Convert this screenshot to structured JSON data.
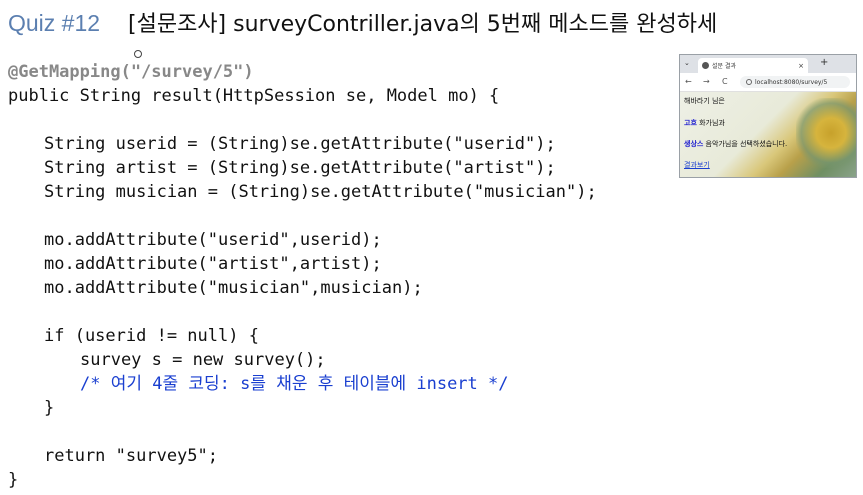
{
  "header": {
    "quiz_label": "Quiz #12",
    "title": "[설문조사] surveyContriller.java의 5번째 메소드를 완성하세"
  },
  "code": {
    "lines": [
      "@GetMapping(\"/survey/5\")",
      "public String result(HttpSession se, Model mo) {",
      "",
      "String userid = (String)se.getAttribute(\"userid\");",
      "String artist = (String)se.getAttribute(\"artist\");",
      "String musician = (String)se.getAttribute(\"musician\");",
      "",
      "mo.addAttribute(\"userid\",userid);",
      "mo.addAttribute(\"artist\",artist);",
      "mo.addAttribute(\"musician\",musician);",
      "",
      "if (userid != null) {",
      "survey s = new survey();",
      "/* 여기 4줄 코딩: s를 채운 후 테이블에 insert */",
      "}",
      "",
      "return \"survey5\";",
      "}"
    ]
  },
  "browser": {
    "tab_title": "설문 결과",
    "tab_close": "×",
    "new_tab": "+",
    "url": "localhost:8080/survey/5",
    "nav_back": "←",
    "nav_forward": "→",
    "nav_reload": "C",
    "page": {
      "line1": "해바라기 님은",
      "artist_value": "고흐",
      "artist_suffix": " 화가님과",
      "musician_value": "생상스",
      "musician_suffix": " 음악가님을 선택하셨습니다.",
      "link": "결과보기"
    }
  }
}
